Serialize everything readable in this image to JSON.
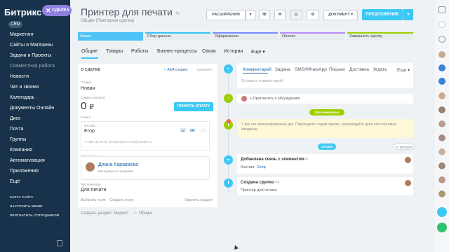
{
  "sidebar": {
    "logo": "Битрикс",
    "badge": "СДЕЛКА",
    "crm": "CRM",
    "items": [
      "Маркетинг",
      "Сайты и Магазины",
      "Задачи и Проекты",
      "Совместная работа",
      "Новости",
      "Чат и звонки",
      "Календарь",
      "Документы Онлайн",
      "Диск",
      "Почта",
      "Группы",
      "Компания",
      "Автоматизация",
      "Приложения",
      "Ещё"
    ],
    "caps": [
      "КАРТА САЙТА",
      "НАСТРОИТЬ МЕНЮ",
      "ПРИГЛАСИТЬ СОТРУДНИКОВ"
    ]
  },
  "header": {
    "title": "Принтер для печати",
    "subtitle": "Общее (Повторная сделка)",
    "btn_extensions": "РАСШИРЕНИЯ",
    "btn_document": "ДОКУМЕНТ",
    "btn_offer": "ПРЕДЛОЖЕНИЕ"
  },
  "stages": [
    "Новая",
    "Сбор данных",
    "Оформление",
    "Оплата",
    "Завершить сделку"
  ],
  "tabs": [
    "Общие",
    "Товары",
    "Роботы",
    "Бизнес-процессы",
    "Связи",
    "История",
    "Еще"
  ],
  "left": {
    "section": "О СДЕЛКЕ",
    "ai": "AI24-скоринг",
    "change": "изменить",
    "stage_label": "Стадия",
    "stage_val": "Новая",
    "sum_label": "Сумма и валюта",
    "sum_val": "0",
    "currency": "₽",
    "pay": "ПРИНЯТЬ ОПЛАТУ",
    "client_label": "Клиент",
    "contact_label": "Контакт",
    "contact_name": "Егор",
    "contact_info": "+7 999 111-00-05, dovxsample24+025@yandex.ru",
    "resp_label": "Ответственный",
    "resp_name": "Диана Караваева",
    "resp_role": "Менеджер по продажам",
    "type_label": "Тип принтера",
    "type_val": "Для печати",
    "choose": "Выбрать поле",
    "create_field": "Создать поле",
    "delete": "Удалить раздел",
    "create_section": "Создать раздел",
    "market": "Маркет",
    "general": "Общее"
  },
  "right": {
    "tabs": [
      "Комментарий",
      "Задача",
      "SMS/WhatsApp",
      "Письмо",
      "Доставка",
      "Ждать",
      "Еще"
    ],
    "comment_ph": "Оставьте комментарий",
    "invite": "Пригласить к обсуждению",
    "planned": "Запланировано",
    "planned_text": "У вас нет запланированных дел. Переводите стадии сделки, запланируйте дело или поставьте ожидание.",
    "today": "сегодня",
    "filter": "ФИЛЬТР",
    "ev1_title": "Добавлена связь с элементом",
    "ev1_time": "20:46",
    "ev1_label": "Контакт",
    "ev1_val": "Егор",
    "ev2_title": "Создана сделка",
    "ev2_time": "20:46",
    "ev2_val": "Принтер для печати"
  },
  "colors": {
    "accent": "#3bc8f5",
    "sidebar": "#17324a",
    "green": "#9dcf00",
    "yellow": "#f9e8a0"
  }
}
